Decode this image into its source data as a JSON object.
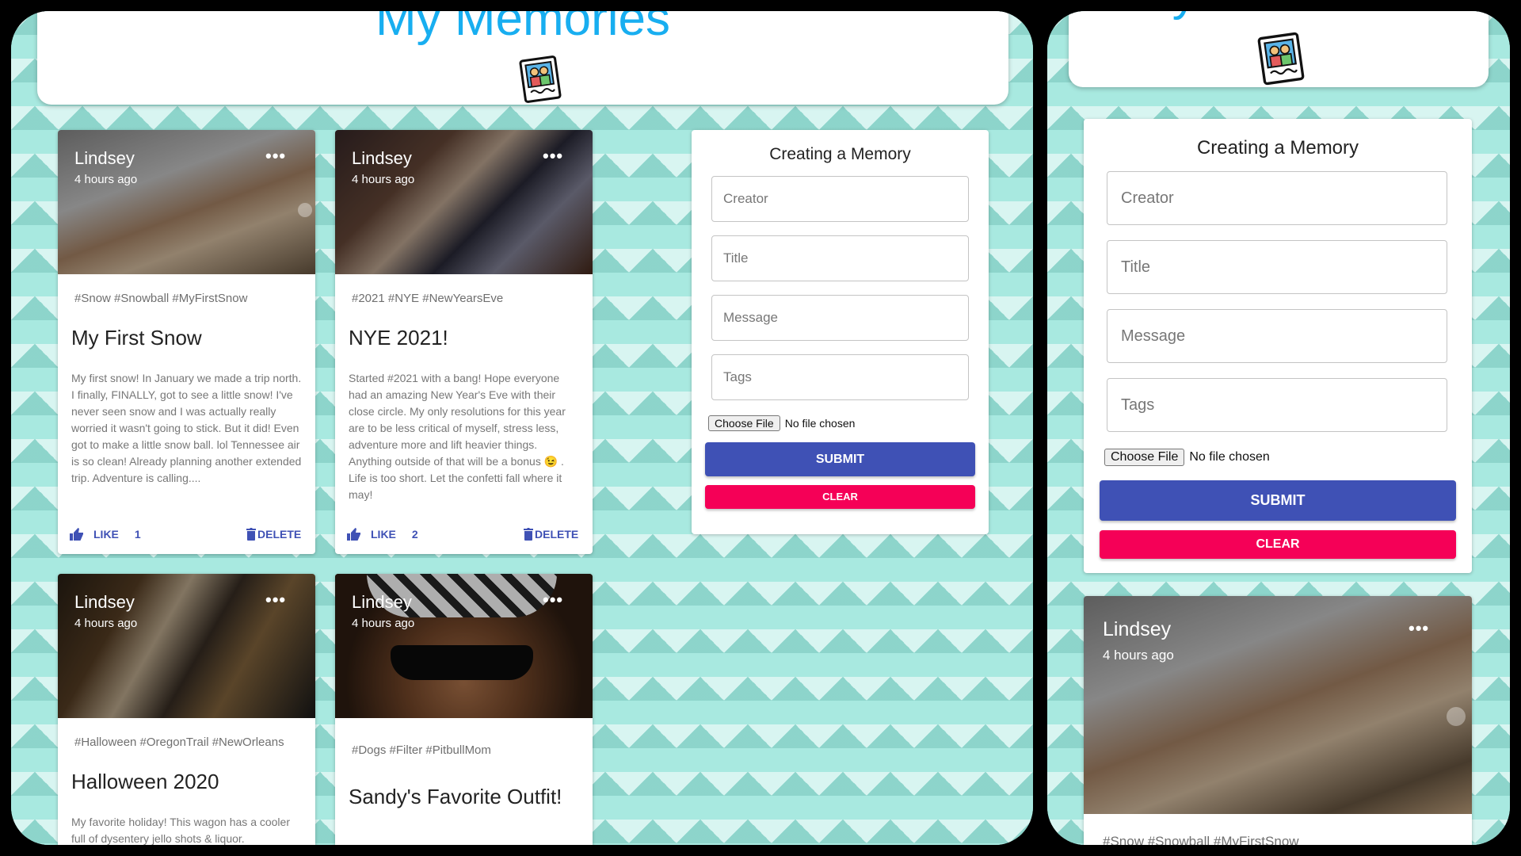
{
  "app": {
    "title": "My Memories"
  },
  "form": {
    "heading": "Creating a Memory",
    "creator_placeholder": "Creator",
    "title_placeholder": "Title",
    "message_placeholder": "Message",
    "tags_placeholder": "Tags",
    "file_button": "Choose File",
    "file_status": "No file chosen",
    "submit": "SUBMIT",
    "clear": "CLEAR"
  },
  "posts": [
    {
      "creator": "Lindsey",
      "time": "4 hours ago",
      "tags": "#Snow #Snowball #MyFirstSnow",
      "title": "My First Snow",
      "message": "My first snow! In January we made a trip north. I finally, FINALLY, got to see a little snow! I've never seen snow and I was actually really worried it wasn't going to stick. But it did! Even got to make a little snow ball. lol Tennessee air is so clean! Already planning another extended trip. Adventure is calling....",
      "like_label": "LIKE",
      "likes": "1",
      "delete_label": "DELETE"
    },
    {
      "creator": "Lindsey",
      "time": "4 hours ago",
      "tags": "#2021 #NYE #NewYearsEve",
      "title": "NYE 2021!",
      "message": "Started #2021 with a bang! Hope everyone had an amazing New Year's Eve with their close circle. My only resolutions for this year are to be less critical of myself, stress less, adventure more and lift heavier things. Anything outside of that will be a bonus 😉 . Life is too short. Let the confetti fall where it may!",
      "like_label": "LIKE",
      "likes": "2",
      "delete_label": "DELETE"
    },
    {
      "creator": "Lindsey",
      "time": "4 hours ago",
      "tags": "#Halloween #OregonTrail #NewOrleans",
      "title": "Halloween 2020",
      "message": "My favorite holiday! This wagon has a cooler full of dysentery jello shots & liquor."
    },
    {
      "creator": "Lindsey",
      "time": "4 hours ago",
      "tags": "#Dogs #Filter #PitbullMom",
      "title": "Sandy's Favorite Outfit!"
    }
  ],
  "mobile": {
    "app_title": "My Memories",
    "post": {
      "creator": "Lindsey",
      "time": "4 hours ago",
      "tags": "#Snow #Snowball #MyFirstSnow"
    }
  },
  "colors": {
    "title": "#18aef0",
    "primary": "#3f51b5",
    "secondary": "#f50057",
    "background": "#a8e9e0"
  },
  "icons": [
    "photo-album-logo-icon",
    "more-horiz-icon",
    "thumb-up-icon",
    "delete-icon",
    "carousel-next-icon"
  ]
}
